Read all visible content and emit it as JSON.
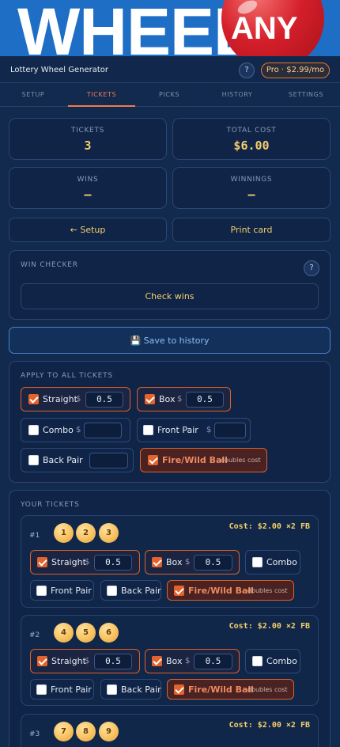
{
  "banner": {
    "word": "WHEEL",
    "ball_text": "ANY"
  },
  "header": {
    "title": "Lottery Wheel Generator",
    "help": "?",
    "pro_label": "Pro · $2.99/mo"
  },
  "tabs": [
    {
      "label": "SETUP"
    },
    {
      "label": "TICKETS"
    },
    {
      "label": "PICKS"
    },
    {
      "label": "HISTORY"
    },
    {
      "label": "SETTINGS"
    }
  ],
  "stats": {
    "tickets_label": "TICKETS",
    "tickets_value": "3",
    "total_cost_label": "TOTAL COST",
    "total_cost_value": "$6.00",
    "wins_label": "WINS",
    "wins_value": "—",
    "winnings_label": "WINNINGS",
    "winnings_value": "—"
  },
  "actions": {
    "setup_label": "← Setup",
    "print_label": "Print card"
  },
  "win_checker": {
    "title": "WIN CHECKER",
    "help": "?",
    "check_label": "Check wins"
  },
  "save_history_label": "💾 Save to history",
  "apply_all": {
    "title": "APPLY TO ALL TICKETS",
    "straight_label": "Straight",
    "straight_amount": "0.5",
    "box_label": "Box",
    "box_amount": "0.5",
    "combo_label": "Combo",
    "combo_amount": "",
    "front_pair_label": "Front Pair",
    "front_pair_amount": "",
    "back_pair_label": "Back Pair",
    "back_pair_amount": "",
    "fire_label": "Fire/Wild Ball",
    "fire_note": "doubles cost",
    "dollar": "$"
  },
  "your_tickets": {
    "title": "YOUR TICKETS",
    "labels": {
      "straight": "Straight",
      "box": "Box",
      "combo": "Combo",
      "front_pair": "Front Pair",
      "back_pair": "Back Pair",
      "fire": "Fire/Wild Ball",
      "fire_note": "doubles cost",
      "dollar": "$"
    },
    "tickets": [
      {
        "num": "#1",
        "balls": [
          "1",
          "2",
          "3"
        ],
        "cost": "Cost: $2.00 ×2 FB",
        "straight_amount": "0.5",
        "box_amount": "0.5"
      },
      {
        "num": "#2",
        "balls": [
          "4",
          "5",
          "6"
        ],
        "cost": "Cost: $2.00 ×2 FB",
        "straight_amount": "0.5",
        "box_amount": "0.5"
      },
      {
        "num": "#3",
        "balls": [
          "7",
          "8",
          "9"
        ],
        "cost": "Cost: $2.00 ×2 FB",
        "straight_amount": "",
        "box_amount": ""
      }
    ]
  },
  "colors": {
    "accent": "#f2794e",
    "gold": "#f7cf6a",
    "background": "#132a4f",
    "banner": "#1f6ec5"
  }
}
